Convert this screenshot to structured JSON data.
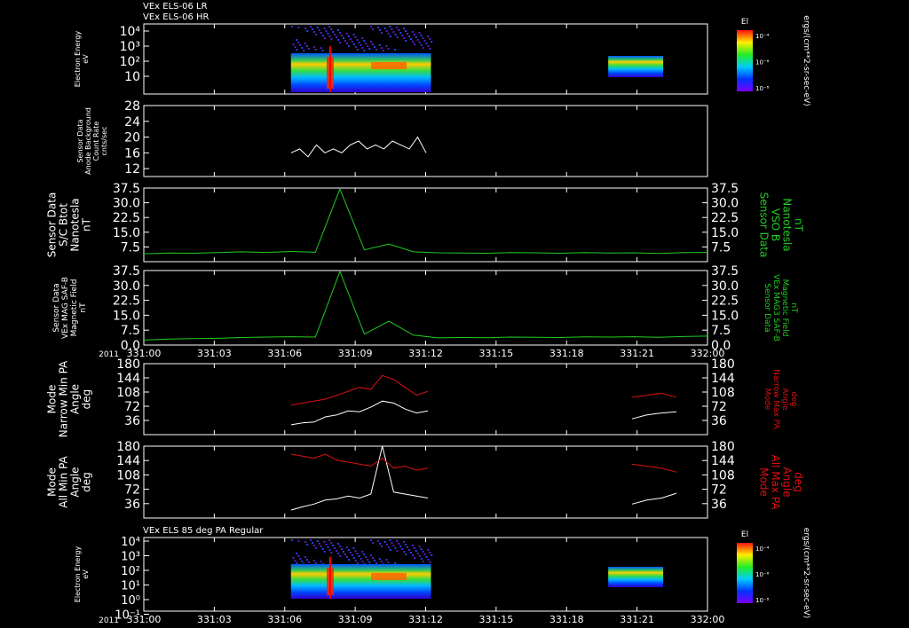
{
  "header": {
    "line1": "VEx ELS-06 LR",
    "line2": "VEx ELS-06 HR",
    "line3": "VEx ELS 85 deg PA Regular"
  },
  "colorbar": {
    "title": "El",
    "units": "ergs/(cm**2-sr-sec-eV)",
    "ticks": [
      "10⁻⁴",
      "10⁻⁶",
      "10⁻⁸"
    ]
  },
  "time_axis": {
    "year": "2011",
    "ticks": [
      "331:00",
      "331:03",
      "331:06",
      "331:09",
      "331:12",
      "331:15",
      "331:18",
      "331:21",
      "332:00"
    ]
  },
  "colors": {
    "background": "#000000",
    "white_trace": "#ffffff",
    "mag_trace": "#22cc22",
    "pa_max_trace": "#dd1111"
  },
  "chart_data": [
    {
      "type": "heatmap",
      "panel": "spectrogram-lr-hr",
      "ylabel": [
        "Electron Energy",
        "eV"
      ],
      "yticks": [
        "10⁴",
        "10³",
        "10²",
        "10"
      ],
      "y_scale": "log",
      "data_intervals": [
        [
          "331:06",
          "331:12"
        ],
        [
          "331:20",
          "331:22"
        ]
      ]
    },
    {
      "type": "line",
      "panel": "anode-background",
      "ylabel": [
        "Sensor Data",
        "Anode Background",
        "Count Rate",
        "cnts/sec"
      ],
      "yticks": [
        "28",
        "24",
        "20",
        "16",
        "12"
      ],
      "ylim": [
        10,
        28
      ],
      "series": [
        {
          "values": [
            16,
            17,
            15,
            18,
            16,
            17,
            16,
            18,
            19,
            17,
            18,
            17,
            19,
            18,
            17,
            20,
            16
          ]
        }
      ]
    },
    {
      "type": "line",
      "panel": "sc-btot",
      "ylabel": [
        "Sensor Data",
        "S/C Btot",
        "Nanotesla",
        "nT"
      ],
      "right_label": [
        "Sensor Data",
        "VSO B",
        "Nanotesla",
        "nT"
      ],
      "yticks": [
        "37.5",
        "30.0",
        "22.5",
        "15.0",
        "7.5"
      ],
      "ylim": [
        0,
        37.5
      ],
      "series": [
        {
          "values": [
            4.0,
            4.4,
            4.3,
            4.6,
            5.0,
            4.7,
            5.2,
            4.8,
            37.0,
            6.0,
            9.0,
            5.0,
            4.5,
            4.4,
            4.3,
            4.6,
            4.5,
            4.3,
            4.6,
            4.4,
            4.5,
            4.2,
            4.6,
            4.7
          ]
        }
      ]
    },
    {
      "type": "line",
      "panel": "mag-saf-b",
      "ylabel": [
        "Sensor Data",
        "VEx MAG SAF-B",
        "Magnetic Field",
        "nT"
      ],
      "right_label": [
        "Sensor Data",
        "VEx MAG3 SAF-B",
        "Magnetic Field",
        "nT"
      ],
      "yticks": [
        "37.5",
        "30.0",
        "22.5",
        "15.0",
        "7.5",
        "0.0"
      ],
      "ylim": [
        0,
        37.5
      ],
      "series": [
        {
          "values": [
            2.5,
            3.0,
            3.2,
            3.4,
            3.8,
            4.0,
            4.2,
            4.0,
            37.0,
            5.5,
            12.0,
            5.0,
            3.6,
            3.8,
            3.7,
            4.0,
            3.9,
            3.8,
            4.1,
            4.0,
            4.2,
            3.9,
            4.3,
            4.5
          ]
        }
      ]
    },
    {
      "type": "line",
      "panel": "narrow-pa",
      "ylabel": [
        "Mode",
        "Narrow Min PA",
        "Angle",
        "deg"
      ],
      "right_label": [
        "Mode",
        "Narrow Max PA",
        "Angle",
        "deg"
      ],
      "yticks": [
        "180",
        "144",
        "108",
        "72",
        "36"
      ],
      "ylim": [
        0,
        180
      ],
      "series": [
        {
          "values": [
            25,
            30,
            32,
            45,
            50,
            60,
            58,
            70,
            85,
            80,
            65,
            55,
            60,
            40,
            50,
            55,
            58
          ]
        },
        {
          "values": [
            75,
            80,
            85,
            90,
            100,
            110,
            120,
            115,
            150,
            140,
            120,
            100,
            110,
            95,
            100,
            105,
            95
          ]
        }
      ]
    },
    {
      "type": "line",
      "panel": "all-pa",
      "ylabel": [
        "Mode",
        "All Min PA",
        "Angle",
        "deg"
      ],
      "right_label": [
        "Mode",
        "All Max PA",
        "Angle",
        "deg"
      ],
      "yticks": [
        "180",
        "144",
        "108",
        "72",
        "36"
      ],
      "ylim": [
        0,
        180
      ],
      "series": [
        {
          "values": [
            20,
            28,
            35,
            45,
            48,
            55,
            50,
            60,
            180,
            65,
            60,
            55,
            50,
            35,
            45,
            50,
            62
          ]
        },
        {
          "values": [
            160,
            155,
            150,
            160,
            145,
            140,
            135,
            130,
            150,
            125,
            130,
            120,
            125,
            135,
            130,
            125,
            115
          ]
        }
      ]
    },
    {
      "type": "heatmap",
      "panel": "spectrogram-85deg",
      "ylabel": [
        "Electron Energy",
        "eV"
      ],
      "yticks": [
        "10⁴",
        "10³",
        "10²",
        "10¹",
        "10⁰",
        "10⁻¹"
      ],
      "y_scale": "log",
      "data_intervals": [
        [
          "331:06",
          "331:12"
        ],
        [
          "331:20",
          "331:22"
        ]
      ]
    }
  ]
}
